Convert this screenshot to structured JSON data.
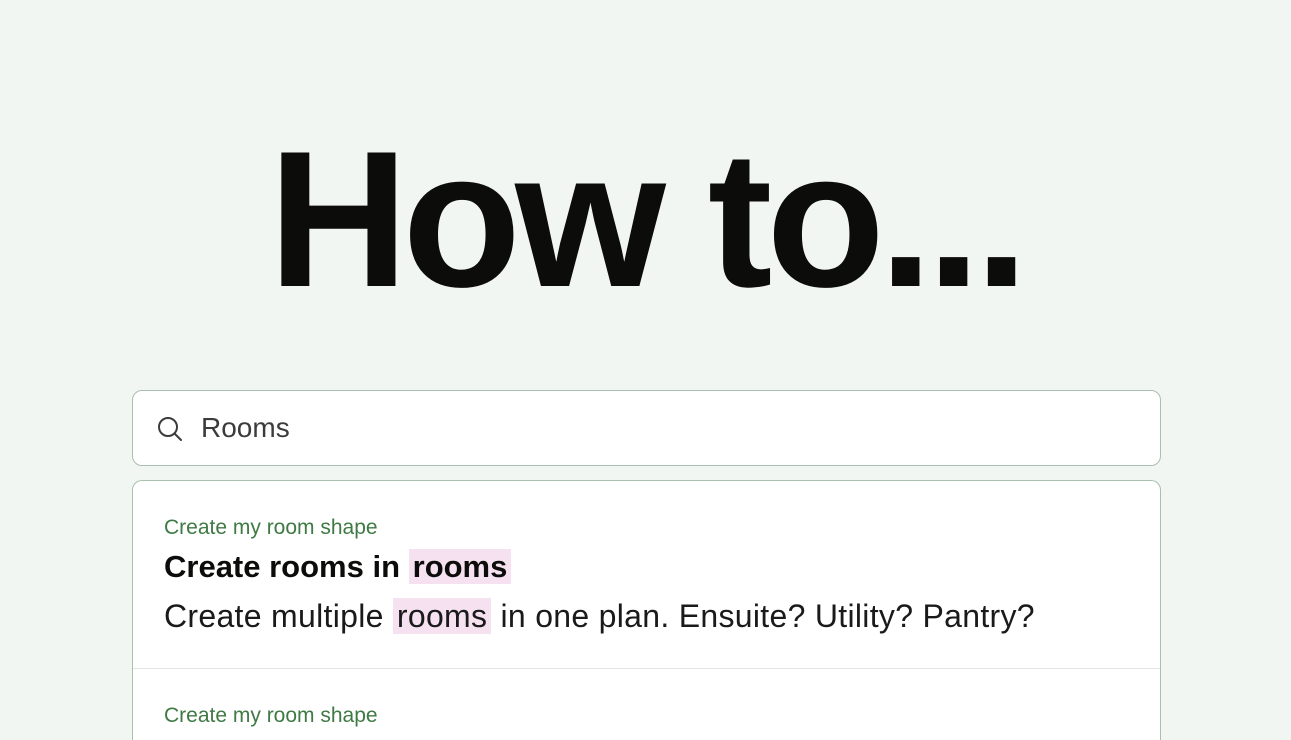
{
  "hero": {
    "title": "How to..."
  },
  "search": {
    "value": "Rooms",
    "placeholder": ""
  },
  "results": [
    {
      "category": "Create my room shape",
      "title_before": "Create rooms in ",
      "title_highlight": "rooms",
      "desc_before": "Create multiple ",
      "desc_highlight": "rooms",
      "desc_after": " in one plan. Ensuite? Utility? Pantry?"
    },
    {
      "category": "Create my room shape"
    }
  ],
  "colors": {
    "background": "#f1f6f2",
    "accent_green": "#3f7a44",
    "highlight": "#f5e1f0",
    "border": "#a8c0ad"
  },
  "icons": {
    "search": "search-icon"
  }
}
